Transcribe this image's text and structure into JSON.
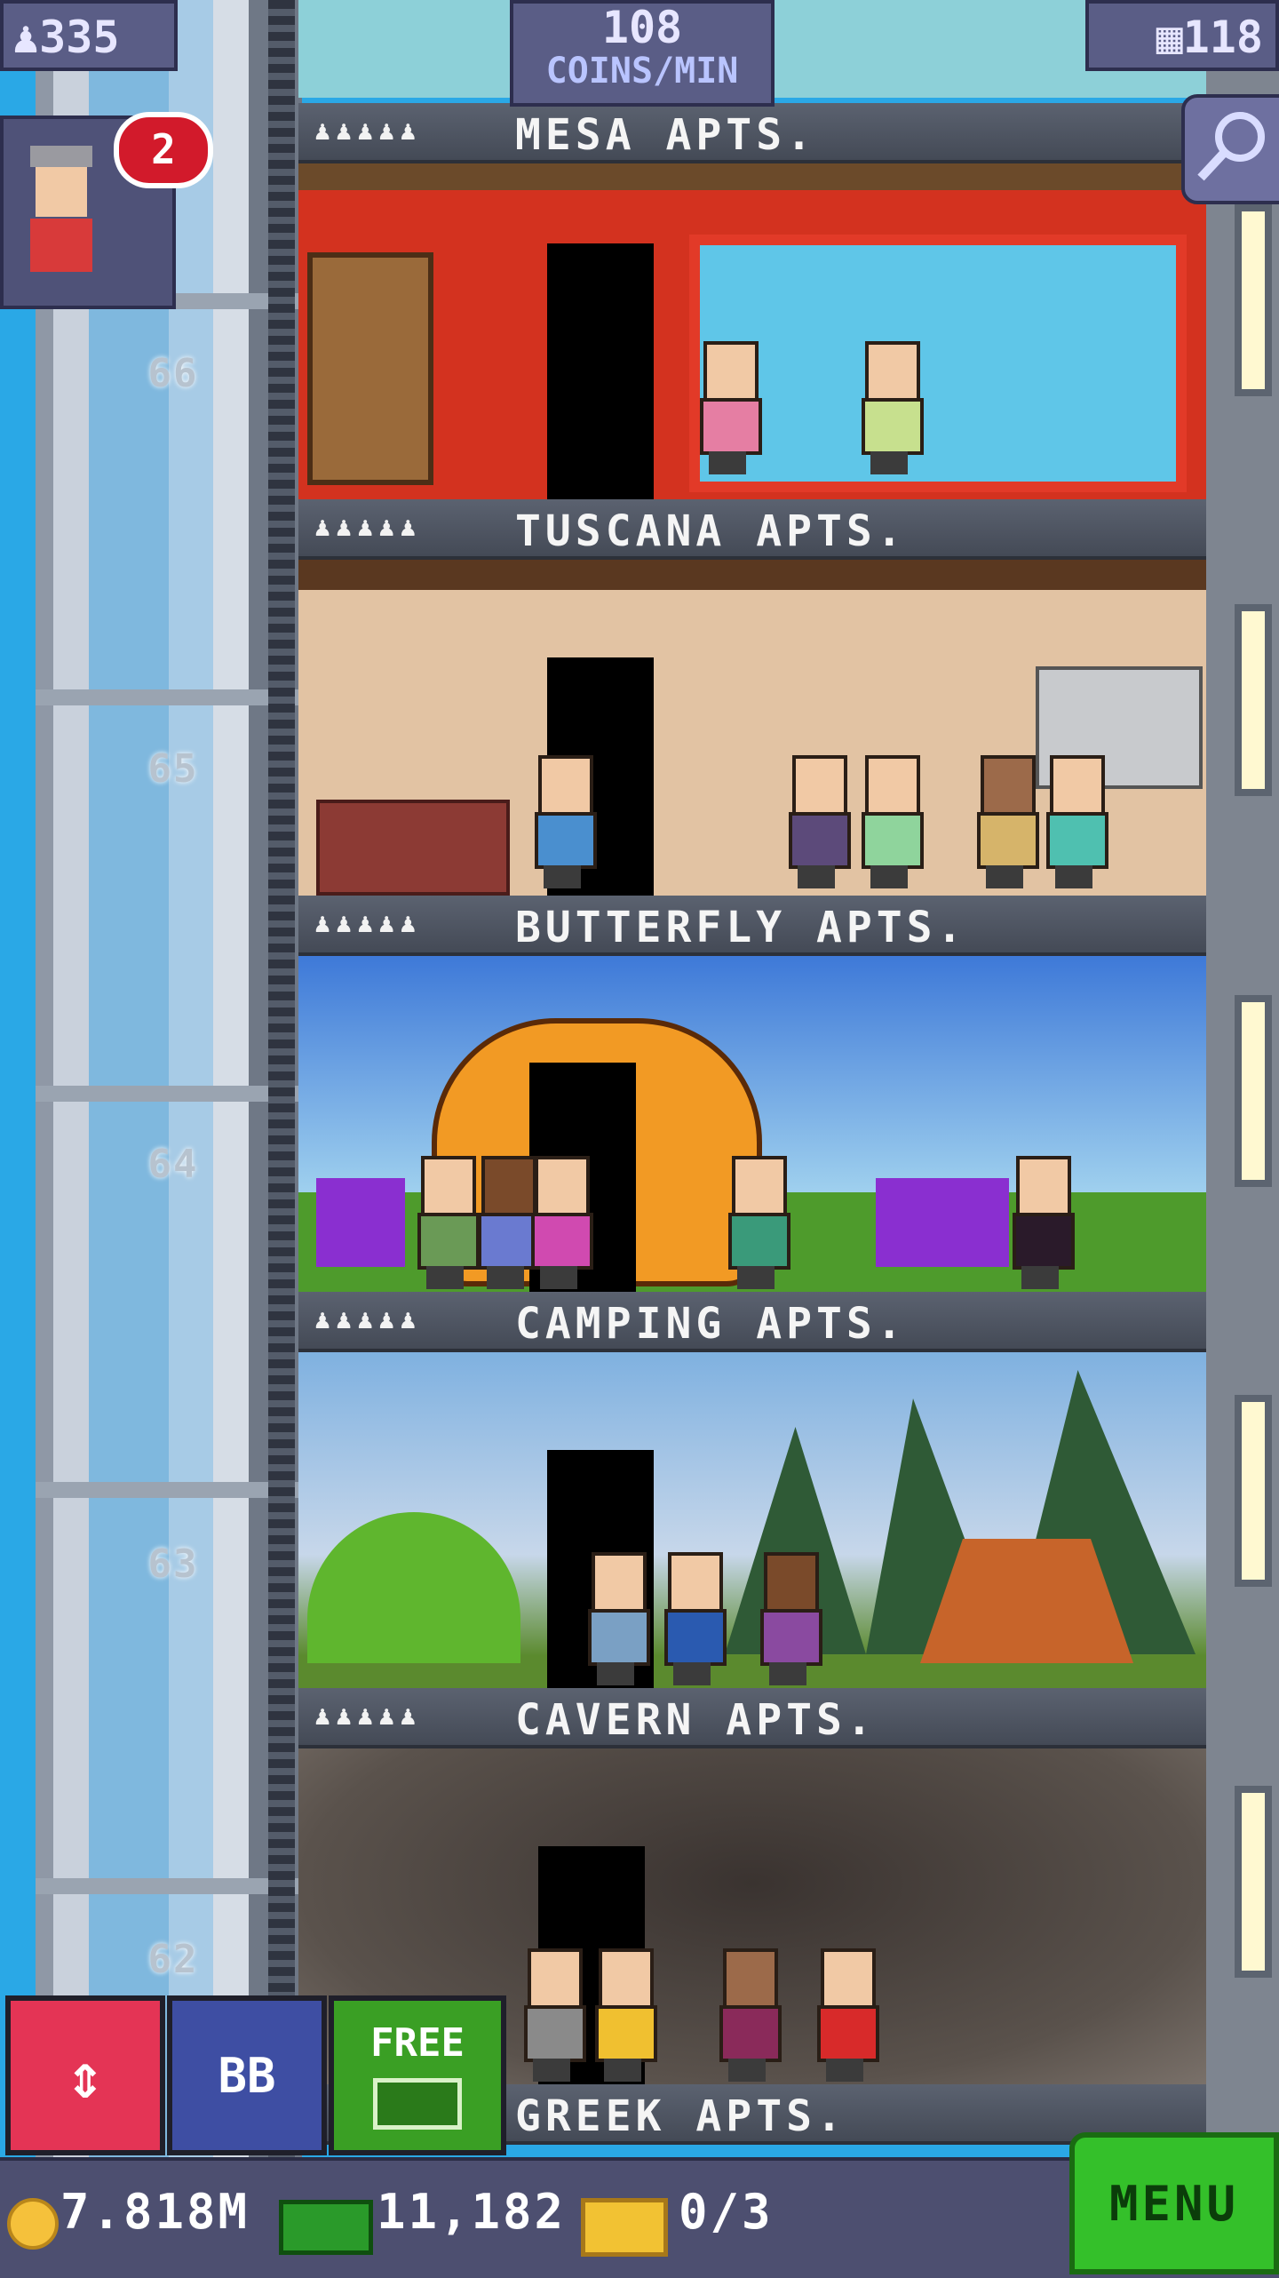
{
  "hud": {
    "population": "335",
    "coin_rate_value": "108",
    "coin_rate_unit": "COINS/MIN",
    "floor_count": "118",
    "visitor_badge": "2"
  },
  "shaft_floor_numbers": [
    "66",
    "65",
    "64",
    "63",
    "62"
  ],
  "floors": [
    {
      "name": "MESA APTS.",
      "stars": "♟♟♟♟♟"
    },
    {
      "name": "TUSCANA APTS.",
      "stars": "♟♟♟♟♟"
    },
    {
      "name": "BUTTERFLY APTS.",
      "stars": "♟♟♟♟♟"
    },
    {
      "name": "CAMPING APTS.",
      "stars": "♟♟♟♟♟"
    },
    {
      "name": "CAVERN APTS.",
      "stars": "♟♟♟♟♟"
    },
    {
      "name": "GREEK APTS."
    }
  ],
  "controls": {
    "elevator_label": "⇕",
    "bb_label": "BB",
    "free_label": "FREE"
  },
  "bottom": {
    "coins": "7.818M",
    "bux": "11,182",
    "tickets": "0/3",
    "menu_label": "MENU"
  },
  "colors": {
    "hud_bg": "#5a5d86",
    "menu_green": "#34c02a",
    "elevator_red": "#e43455",
    "bb_blue": "#3e4ea3",
    "free_green": "#3a9f24"
  }
}
